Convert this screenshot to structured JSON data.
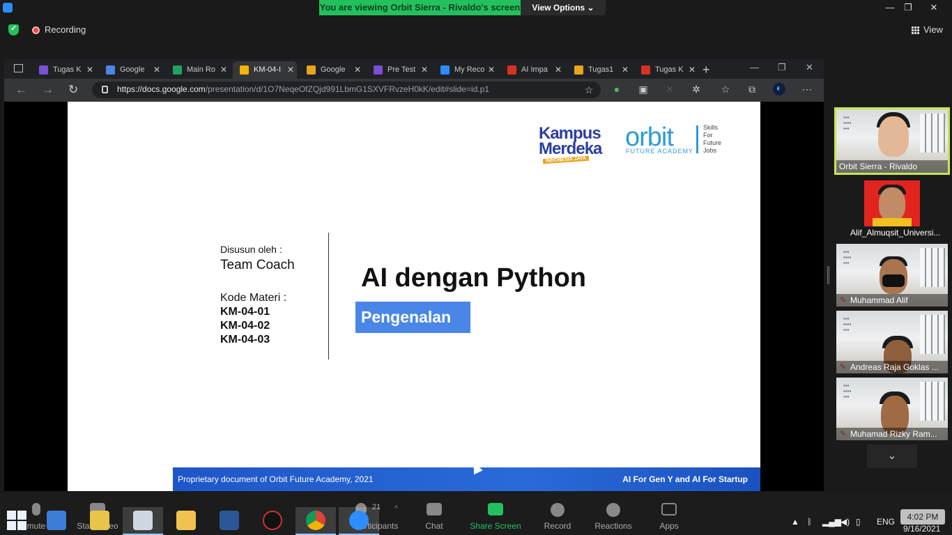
{
  "zoom": {
    "banner": "You are viewing Orbit Sierra - Rivaldo's screen",
    "view_options": "View Options ⌄",
    "recording": "Recording",
    "view": "View",
    "window_controls": [
      "—",
      "❐",
      "✕"
    ]
  },
  "browser": {
    "tabs": [
      {
        "label": "Tugas K",
        "color": "#7b4fd6"
      },
      {
        "label": "Google",
        "color": "#4a86e8"
      },
      {
        "label": "Main Ro",
        "color": "#1fa463"
      },
      {
        "label": "KM-04-I",
        "color": "#f4b400",
        "active": true
      },
      {
        "label": "Google",
        "color": "#e8a41c"
      },
      {
        "label": "Pre Test",
        "color": "#7b4fd6"
      },
      {
        "label": "My Reco",
        "color": "#2d8cff"
      },
      {
        "label": "AI Impa",
        "color": "#d93025"
      },
      {
        "label": "Tugas1",
        "color": "#e8a41c"
      },
      {
        "label": "Tugas K",
        "color": "#d93025"
      }
    ],
    "tab_close": "✕",
    "new_tab": "+",
    "url_host": "https://docs.google.com",
    "url_path": "/presentation/d/1O7NeqeOfZQjd991LbmG1SXVFRvzeH0kK/edit#slide=id.p1"
  },
  "slide": {
    "kampus_line1": "Kampus",
    "kampus_line2": "Merdeka",
    "kampus_tag": "INDONESIA JAYA",
    "orbit": "orbit",
    "orbit_sub": "FUTURE ACADEMY",
    "orbit_skills": [
      "Skills",
      "For",
      "Future",
      "Jobs"
    ],
    "disusun_label": "Disusun oleh :",
    "author": "Team Coach",
    "kode_label": "Kode Materi :",
    "kode_items": [
      "KM-04-01",
      "KM-04-02",
      "KM-04-03"
    ],
    "title": "AI dengan Python",
    "subtitle": "Pengenalan",
    "footer_left": "Proprietary document of Orbit Future Academy, 2021",
    "footer_right": "AI For Gen Y and AI For Startup"
  },
  "participants": [
    {
      "name": "Orbit Sierra - Rivaldo",
      "muted": false
    },
    {
      "name": "Alif_Almuqsit_Universi...",
      "muted": true
    },
    {
      "name": "Muhammad Alif",
      "muted": true
    },
    {
      "name": "Andreas Raja Goklas ...",
      "muted": true
    },
    {
      "name": "Muhamad Rizky Ram...",
      "muted": true
    }
  ],
  "toolbar": {
    "buttons": [
      "mute",
      "Start Video",
      "Participants",
      "Chat",
      "Share Screen",
      "Record",
      "Reactions",
      "Apps"
    ],
    "participant_count": "21"
  },
  "taskbar": {
    "lang": "ENG",
    "time": "4:02 PM",
    "date": "9/16/2021"
  }
}
